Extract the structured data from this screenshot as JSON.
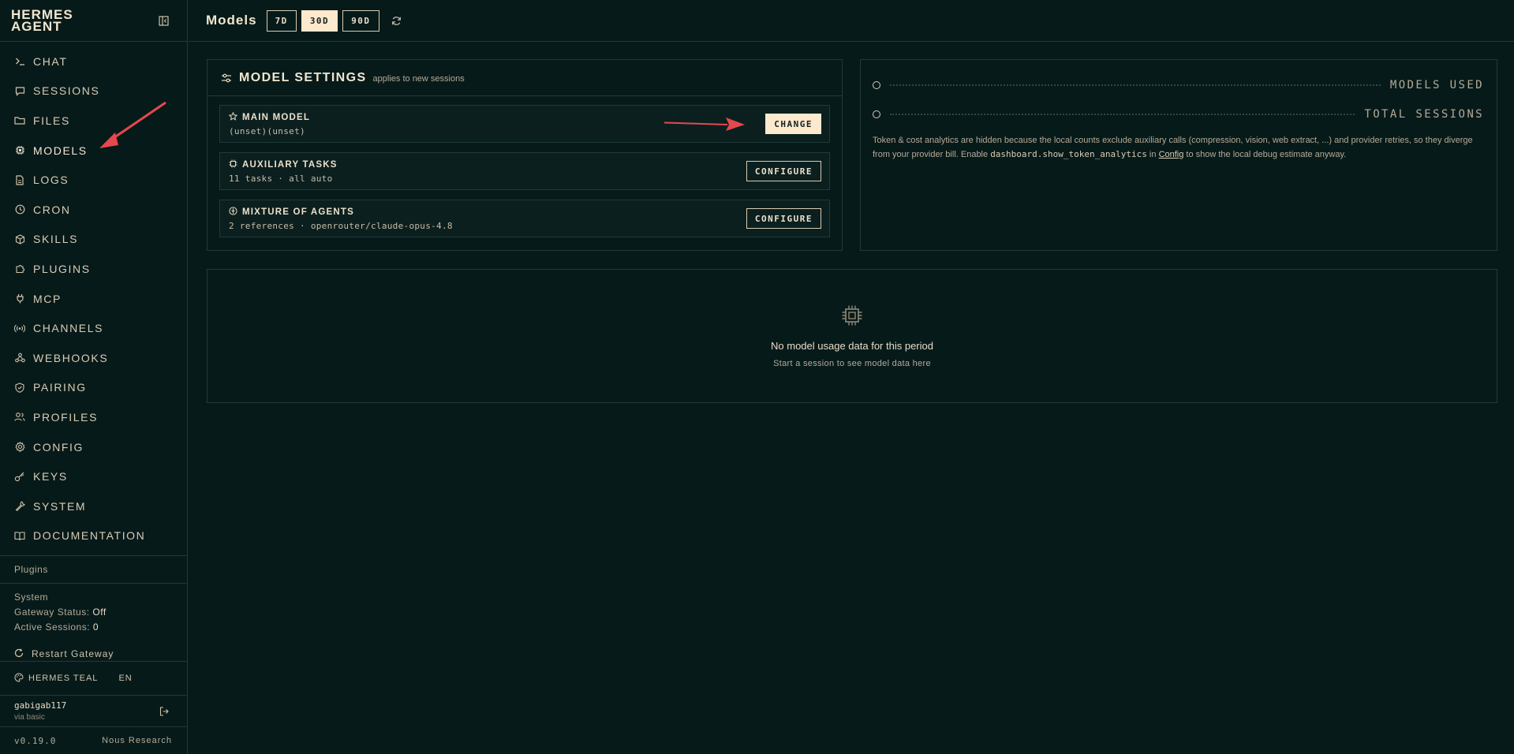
{
  "brand": {
    "line1": "HERMES",
    "line2": "AGENT"
  },
  "nav": [
    {
      "label": "CHAT",
      "icon": "terminal-icon"
    },
    {
      "label": "SESSIONS",
      "icon": "message-icon"
    },
    {
      "label": "FILES",
      "icon": "folder-icon"
    },
    {
      "label": "MODELS",
      "icon": "cpu-icon"
    },
    {
      "label": "LOGS",
      "icon": "file-text-icon"
    },
    {
      "label": "CRON",
      "icon": "clock-icon"
    },
    {
      "label": "SKILLS",
      "icon": "package-icon"
    },
    {
      "label": "PLUGINS",
      "icon": "puzzle-icon"
    },
    {
      "label": "MCP",
      "icon": "plug-icon"
    },
    {
      "label": "CHANNELS",
      "icon": "radio-icon"
    },
    {
      "label": "WEBHOOKS",
      "icon": "webhook-icon"
    },
    {
      "label": "PAIRING",
      "icon": "shield-icon"
    },
    {
      "label": "PROFILES",
      "icon": "users-icon"
    },
    {
      "label": "CONFIG",
      "icon": "gear-icon"
    },
    {
      "label": "KEYS",
      "icon": "key-icon"
    },
    {
      "label": "SYSTEM",
      "icon": "wrench-icon"
    },
    {
      "label": "DOCUMENTATION",
      "icon": "book-icon"
    }
  ],
  "plugins_section": "Plugins",
  "system": {
    "heading": "System",
    "gateway_label": "Gateway Status:",
    "gateway_value": "Off",
    "sessions_label": "Active Sessions:",
    "sessions_value": "0",
    "restart_label": "Restart Gateway"
  },
  "theme": {
    "name": "HERMES TEAL",
    "lang": "EN"
  },
  "user": {
    "name": "gabigab117",
    "via": "via basic"
  },
  "footer": {
    "version": "v0.19.0",
    "vendor": "Nous Research"
  },
  "header": {
    "title": "Models",
    "ranges": [
      "7D",
      "30D",
      "90D"
    ],
    "selected_range": "30D"
  },
  "model_settings": {
    "title": "MODEL SETTINGS",
    "subtitle": "applies to new sessions",
    "rows": [
      {
        "title": "MAIN MODEL",
        "sub": "(unset)(unset)",
        "action": "CHANGE",
        "icon": "star-icon"
      },
      {
        "title": "AUXILIARY TASKS",
        "sub": "11 tasks · all auto",
        "action": "CONFIGURE",
        "icon": "cpu-icon"
      },
      {
        "title": "MIXTURE OF AGENTS",
        "sub": "2 references · openrouter/claude-opus-4.8",
        "action": "CONFIGURE",
        "icon": "layers-icon"
      }
    ]
  },
  "stats": {
    "models_used": "MODELS USED",
    "total_sessions": "TOTAL SESSIONS",
    "note_before": "Token & cost analytics are hidden because the local counts exclude auxiliary calls (compression, vision, web extract, ...) and provider retries, so they diverge from your provider bill. Enable ",
    "note_code": "dashboard.show_token_analytics",
    "note_mid": " in ",
    "note_link": "Config",
    "note_after": " to show the local debug estimate anyway."
  },
  "empty": {
    "title": "No model usage data for this period",
    "sub": "Start a session to see model data here"
  },
  "colors": {
    "background": "#071a1a",
    "accent": "#fde9cd",
    "text": "#e6dcc6",
    "border": "#1f3b39",
    "annotation": "#e5484d"
  }
}
